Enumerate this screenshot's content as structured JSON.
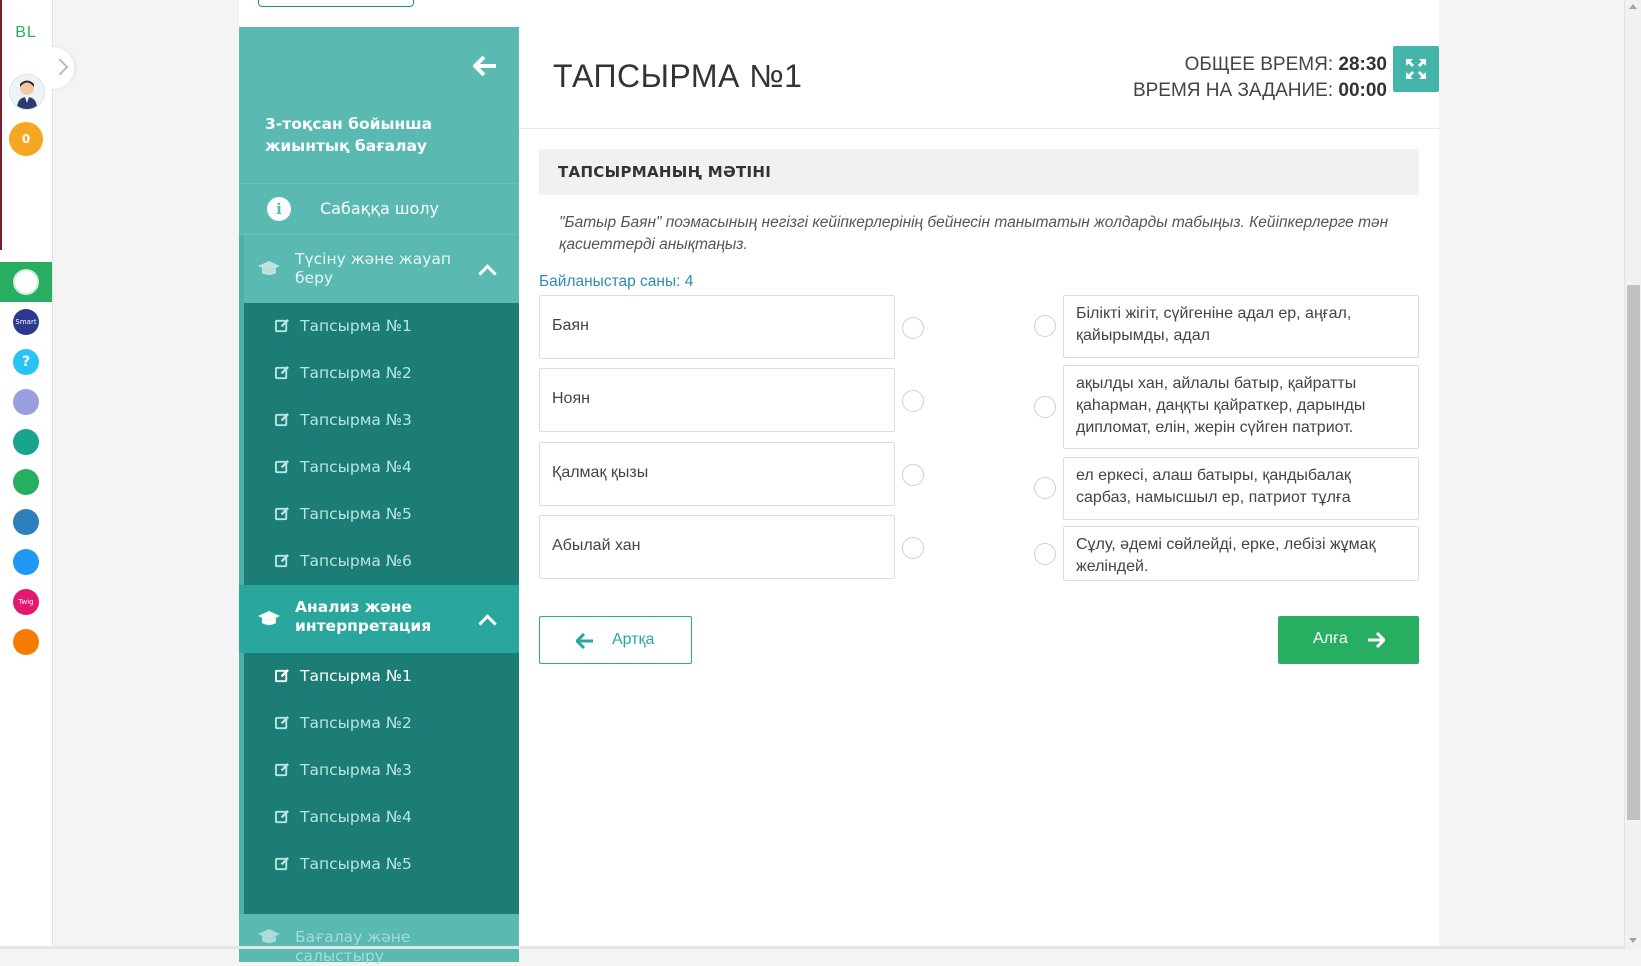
{
  "rail": {
    "logo": "BL",
    "coins": "0",
    "apps": [
      {
        "name": "bilimland-app",
        "label": "",
        "color": "#2ecc71"
      },
      {
        "name": "smart-nation-app",
        "label": "Smart",
        "color": "#2b3990"
      },
      {
        "name": "help-app",
        "label": "?",
        "color": "#29c4f6"
      },
      {
        "name": "keyboard-app",
        "label": "",
        "color": "#9b9fe0"
      },
      {
        "name": "bilim-media-app",
        "label": "",
        "color": "#1aa38f"
      },
      {
        "name": "bilim-land-app",
        "label": "",
        "color": "#27ae60"
      },
      {
        "name": "bilim-book-app",
        "label": "",
        "color": "#2c7fb8"
      },
      {
        "name": "test-app",
        "label": "",
        "color": "#2196f3"
      },
      {
        "name": "twig-app",
        "label": "Twig",
        "color": "#e6176e"
      },
      {
        "name": "imektep-app",
        "label": "",
        "color": "#f57c00"
      }
    ]
  },
  "sidebar": {
    "title": "3-тоқсан бойынша жиынтық бағалау",
    "overview": "Сабаққа шолу",
    "sections": [
      {
        "label": "Түсіну және жауап беру",
        "items": [
          "Тапсырма №1",
          "Тапсырма №2",
          "Тапсырма №3",
          "Тапсырма №4",
          "Тапсырма №5",
          "Тапсырма №6"
        ]
      },
      {
        "label": "Анализ және интерпретация",
        "items": [
          "Тапсырма №1",
          "Тапсырма №2",
          "Тапсырма №3",
          "Тапсырма №4",
          "Тапсырма №5"
        ]
      },
      {
        "label": "Бағалау және салыстыру",
        "items": []
      }
    ]
  },
  "header": {
    "title": "ТАПСЫРМА №1",
    "total_time_label": "ОБЩЕЕ ВРЕМЯ:",
    "total_time_value": "28:30",
    "task_time_label": "ВРЕМЯ НА ЗАДАНИЕ:",
    "task_time_value": "00:00"
  },
  "task": {
    "heading": "ТАПСЫРМАНЫҢ МӘТІНІ",
    "text": "\"Батыр Баян\" поэмасының негізгі кейіпкерлерінің бейнесін танытатын жолдарды табыңыз. Кейіпкерлерге тән қасиеттерді анықтаңыз.",
    "connections": "Байланыстар саны: 4",
    "left": [
      "Баян",
      "Ноян",
      "Қалмақ қызы",
      "Абылай хан"
    ],
    "right": [
      "Білікті жігіт, сүйгеніне адал ер, аңғал, қайырымды, адал",
      "ақылды хан, айлалы батыр, қайратты қаһарман, даңқты қайраткер, дарынды дипломат, елін, жерін сүйген патриот.",
      "ел еркесі, алаш батыры, қандыбалақ сарбаз, намысшыл ер, патриот тұлға",
      "Сұлу, әдемі сөйлейді, ерке, лебізі жұмақ желіндей."
    ]
  },
  "nav": {
    "back": "Артқа",
    "next": "Алға"
  }
}
